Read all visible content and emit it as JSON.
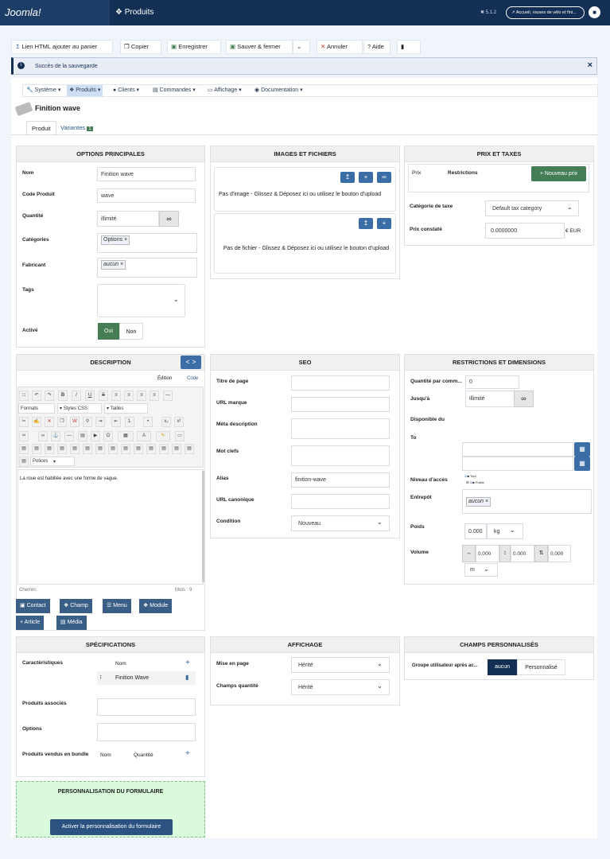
{
  "app": {
    "logo": "Joomla!",
    "title": "Produits",
    "version": "5.1.2",
    "user": "Accueil, rouses de vélo et fini..."
  },
  "toolbar": {
    "b1": "Lien HTML ajouter au panier",
    "b2": "Copier",
    "b3": "Enregistrer",
    "b4": "Sauver & fermer",
    "b5": "Annuler",
    "b6": "Aide"
  },
  "alert": {
    "message": "Succès de la sauvegarde"
  },
  "submenu": {
    "sys": "Système",
    "prod": "Produits",
    "cli": "Clients",
    "cmd": "Commandes",
    "aff": "Affichage",
    "doc": "Documentation"
  },
  "product": {
    "title": "Finition wave"
  },
  "tabs": {
    "t1": "Produit",
    "t2": "Variantes",
    "badge": "1"
  },
  "opt": {
    "header": "OPTIONS PRINCIPALES",
    "nom_l": "Nom",
    "nom_v": "Finition wave",
    "code_l": "Code Produit",
    "code_v": "wave",
    "qty_l": "Quantité",
    "qty_v": "illimité",
    "cat_l": "Catégories",
    "cat_v": "Options",
    "fab_l": "Fabricant",
    "fab_v": "aucun",
    "tags_l": "Tags",
    "act_l": "Activé",
    "oui": "Oui",
    "non": "Non"
  },
  "img": {
    "header": "IMAGES ET FICHIERS",
    "noimg": "Pas d'image - Glissez & Déposez ici ou utilisez le bouton d'upload",
    "nofile": "Pas de fichier - Glissez & Déposez ici ou utilisez le bouton d'upload"
  },
  "prix": {
    "header": "PRIX ET TAXES",
    "prix_col": "Prix",
    "restr_col": "Restrictions",
    "new_btn": "+ Nouveau prix",
    "tax_l": "Catégorie de taxe",
    "tax_v": "Default tax category",
    "pc_l": "Prix constaté",
    "pc_v": "0.0000000",
    "cur": "€ EUR"
  },
  "desc": {
    "header": "DESCRIPTION",
    "edition": "Édition",
    "code": "Code",
    "formats": "Formats",
    "styles": "Styles CSS",
    "tailles": "Tailles",
    "polices": "Polices",
    "content": "La roue est habillée avec une forme de vague.",
    "path": "Chemin:",
    "words": "Mots : 9"
  },
  "seo": {
    "header": "SEO",
    "titre": "Titre de page",
    "url": "URL marque",
    "meta": "Méta description",
    "mots": "Mot clefs",
    "alias": "Alias",
    "alias_v": "finition-wave",
    "canon": "URL canonique",
    "cond": "Condition",
    "cond_v": "Nouveau"
  },
  "restr": {
    "header": "RESTRICTIONS ET DIMENSIONS",
    "qpc": "Quantité par comm...",
    "qpc_v": "0",
    "jusqua": "Jusqu'à",
    "jusqua_v": "illimité",
    "dispo": "Disponible du",
    "to": "To",
    "acces": "Niveau d'accès",
    "public": "Tout",
    "public2": "Public",
    "entrepot": "Entrepôt",
    "entrepot_v": "aucun",
    "poids": "Poids",
    "poids_v": "0.000",
    "kg": "kg",
    "volume": "Volume",
    "v1": "0.000",
    "v2": "0.000",
    "v3": "0.000",
    "m": "m"
  },
  "bottombtns": {
    "contact": "Contact",
    "champ": "Champ",
    "menu": "Menu",
    "module": "Module",
    "article": "Article",
    "media": "Média"
  },
  "spec": {
    "header": "SPÉCIFICATIONS",
    "carac": "Caractéristiques",
    "nom": "Nom",
    "row": "Finition Wave",
    "assoc": "Produits associés",
    "options": "Options",
    "bundle": "Produits vendus en bundle",
    "nom2": "Nom",
    "quantite": "Quantité"
  },
  "aff": {
    "header": "AFFICHAGE",
    "mise": "Mise en page",
    "mise_v": "Hérité",
    "champq": "Champs quantité",
    "champq_v": "Hérité"
  },
  "champs": {
    "header": "CHAMPS PERSONNALISÉS",
    "groupe": "Groupe utilisateur après ac...",
    "aucun": "aucun",
    "perso": "Personnalisé"
  },
  "form": {
    "header": "PERSONNALISATION DU FORMULAIRE",
    "btn": "Activer la personnalisation du formulaire"
  }
}
